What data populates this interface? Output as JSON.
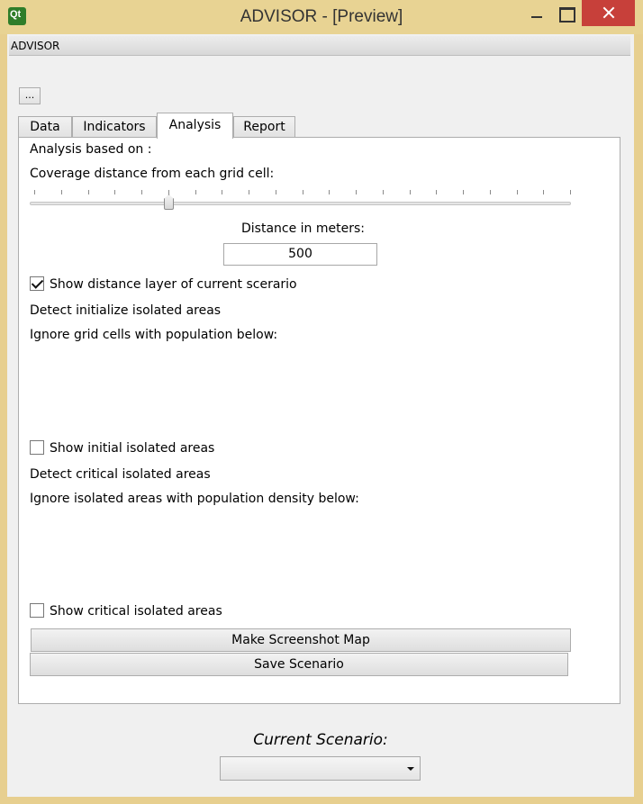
{
  "window": {
    "title": "ADVISOR - [Preview]",
    "app_icon_text": "Qt",
    "icon": "qt-logo-icon"
  },
  "menubar": {
    "label": "ADVISOR"
  },
  "toolbar": {
    "browse_label": "..."
  },
  "tabs": [
    {
      "label": "Data",
      "active": false
    },
    {
      "label": "Indicators",
      "active": false
    },
    {
      "label": "Analysis",
      "active": true
    },
    {
      "label": "Report",
      "active": false
    }
  ],
  "analysis": {
    "based_on_label": "Analysis based on :",
    "coverage_label": "Coverage distance from each grid cell:",
    "slider": {
      "tick_count": 21,
      "position_fraction": 0.25
    },
    "distance_label": "Distance in meters:",
    "distance_value": "500",
    "show_distance_layer": {
      "label": "Show distance layer of current scerario",
      "checked": true
    },
    "detect_initial_label": "Detect initialize isolated areas",
    "ignore_grid_label": "Ignore grid cells with population below:",
    "show_initial": {
      "label": "Show initial isolated areas",
      "checked": false
    },
    "detect_critical_label": "Detect critical isolated areas",
    "ignore_density_label": "Ignore isolated areas with population density below:",
    "show_critical": {
      "label": "Show critical isolated areas",
      "checked": false
    },
    "screenshot_button": "Make Screenshot Map",
    "save_button": "Save Scenario"
  },
  "scenario": {
    "label": "Current Scenario:",
    "selected": ""
  },
  "colors": {
    "window_frame": "#e7cf8f",
    "close_button": "#c7403a",
    "panel_background": "#ffffff"
  }
}
